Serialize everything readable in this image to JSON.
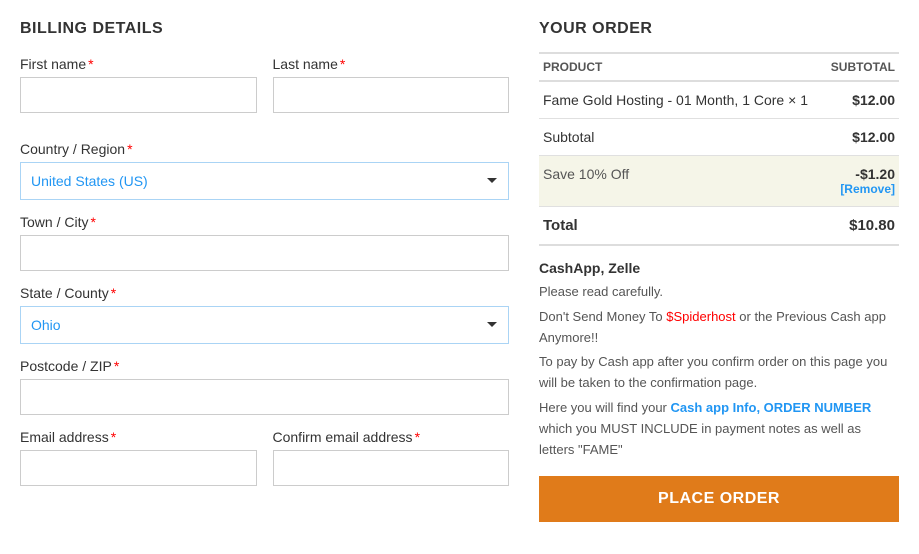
{
  "billing": {
    "title": "BILLING DETAILS",
    "first_name_label": "First name",
    "last_name_label": "Last name",
    "country_label": "Country / Region",
    "country_value": "United States (US)",
    "town_label": "Town / City",
    "state_label": "State / County",
    "state_value": "Ohio",
    "postcode_label": "Postcode / ZIP",
    "email_label": "Email address",
    "confirm_email_label": "Confirm email address",
    "required_star": "*"
  },
  "order": {
    "title": "YOUR ORDER",
    "product_col": "PRODUCT",
    "subtotal_col": "SUBTOTAL",
    "product_name": "Fame Gold Hosting - 01 Month, 1 Core",
    "product_qty": "× 1",
    "product_price": "$12.00",
    "subtotal_label": "Subtotal",
    "subtotal_value": "$12.00",
    "coupon_label": "Save 10% Off",
    "coupon_discount": "-$1.20",
    "coupon_remove": "[Remove]",
    "total_label": "Total",
    "total_value": "$10.80"
  },
  "payment": {
    "title": "CashApp, Zelle",
    "line1": "Please read carefully.",
    "line2_prefix": "Don't Send Money To ",
    "line2_highlight": "$Spiderhost",
    "line2_suffix": " or the Previous Cash app Anymore!!",
    "line3": "To pay by Cash app after you confirm order on this page you will be taken to the confirmation page.",
    "line4_prefix": "Here you will find your ",
    "line4_link": "Cash app Info, ORDER NUMBER",
    "line4_suffix": " which you MUST INCLUDE in payment notes as well as letters \"FAME\"",
    "place_order_btn": "PLACE ORDER"
  }
}
